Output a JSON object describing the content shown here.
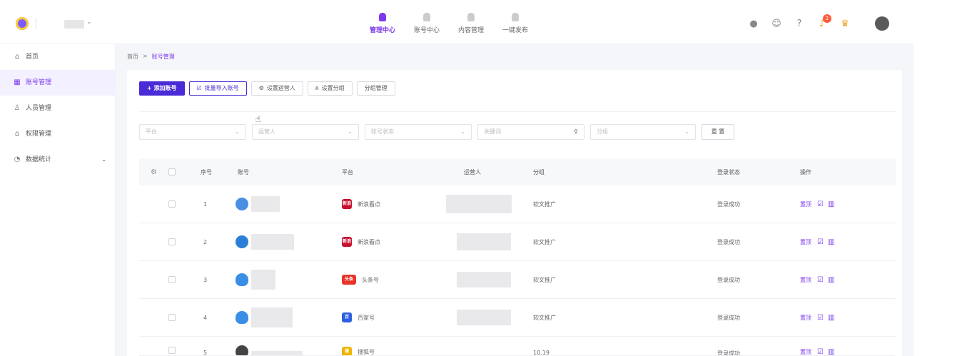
{
  "topnav": [
    {
      "label": "管理中心",
      "active": true
    },
    {
      "label": "账号中心",
      "active": false
    },
    {
      "label": "内容管理",
      "active": false
    },
    {
      "label": "一键发布",
      "active": false
    }
  ],
  "top_icons": [
    "message-icon",
    "robot-icon",
    "help-icon",
    "bell-icon",
    "crown-icon"
  ],
  "notification_count": "2",
  "sidebar": {
    "items": [
      {
        "label": "首页",
        "icon": "home-icon"
      },
      {
        "label": "账号管理",
        "icon": "grid-icon"
      },
      {
        "label": "人员管理",
        "icon": "user-icon"
      },
      {
        "label": "权限管理",
        "icon": "lock-icon"
      },
      {
        "label": "数据统计",
        "icon": "chart-icon"
      }
    ]
  },
  "breadcrumb": {
    "home": "首页",
    "sep": ">",
    "current": "账号管理"
  },
  "toolbar": {
    "add": "+ 添加账号",
    "import": "批量导入账号",
    "set_operator": "设置运营人",
    "set_group": "设置分组",
    "group_manage": "分组管理"
  },
  "filters": {
    "platform": "平台",
    "operator": "运营人",
    "status": "账号状态",
    "keyword": "关键词",
    "group": "分组",
    "reset": "重 置"
  },
  "table": {
    "headers": {
      "index": "序号",
      "account": "账号",
      "platform": "平台",
      "operator": "运营人",
      "group": "分组",
      "login_status": "登录状态",
      "actions": "操作"
    },
    "rows": [
      {
        "index": "1",
        "platform": "新浪看点",
        "platform_tag": "新浪",
        "platform_color": "#c8102e",
        "group": "软文推广",
        "status": "登录成功",
        "action": "置顶",
        "avatar_color": "#4a90e2"
      },
      {
        "index": "2",
        "platform": "新浪看点",
        "platform_tag": "新浪",
        "platform_color": "#c8102e",
        "group": "软文推广",
        "status": "登录成功",
        "action": "置顶",
        "avatar_color": "#2b7fd6"
      },
      {
        "index": "3",
        "platform": "头条号",
        "platform_tag": "头条",
        "platform_color": "#e6352b",
        "group": "软文推广",
        "status": "登录成功",
        "action": "置顶",
        "avatar_color": "#3a8ee6"
      },
      {
        "index": "4",
        "platform": "百家号",
        "platform_tag": "百",
        "platform_color": "#2d5fe0",
        "group": "软文推广",
        "status": "登录成功",
        "action": "置顶",
        "avatar_color": "#3a8ee6"
      },
      {
        "index": "5",
        "platform": "搜狐号",
        "platform_tag": "搜",
        "platform_color": "#f0b400",
        "group": "10.19",
        "status": "登录成功",
        "action": "置顶",
        "avatar_color": "#444444"
      }
    ]
  },
  "colors": {
    "accent": "#7c3aed",
    "primary_button": "#4b2bd6"
  }
}
